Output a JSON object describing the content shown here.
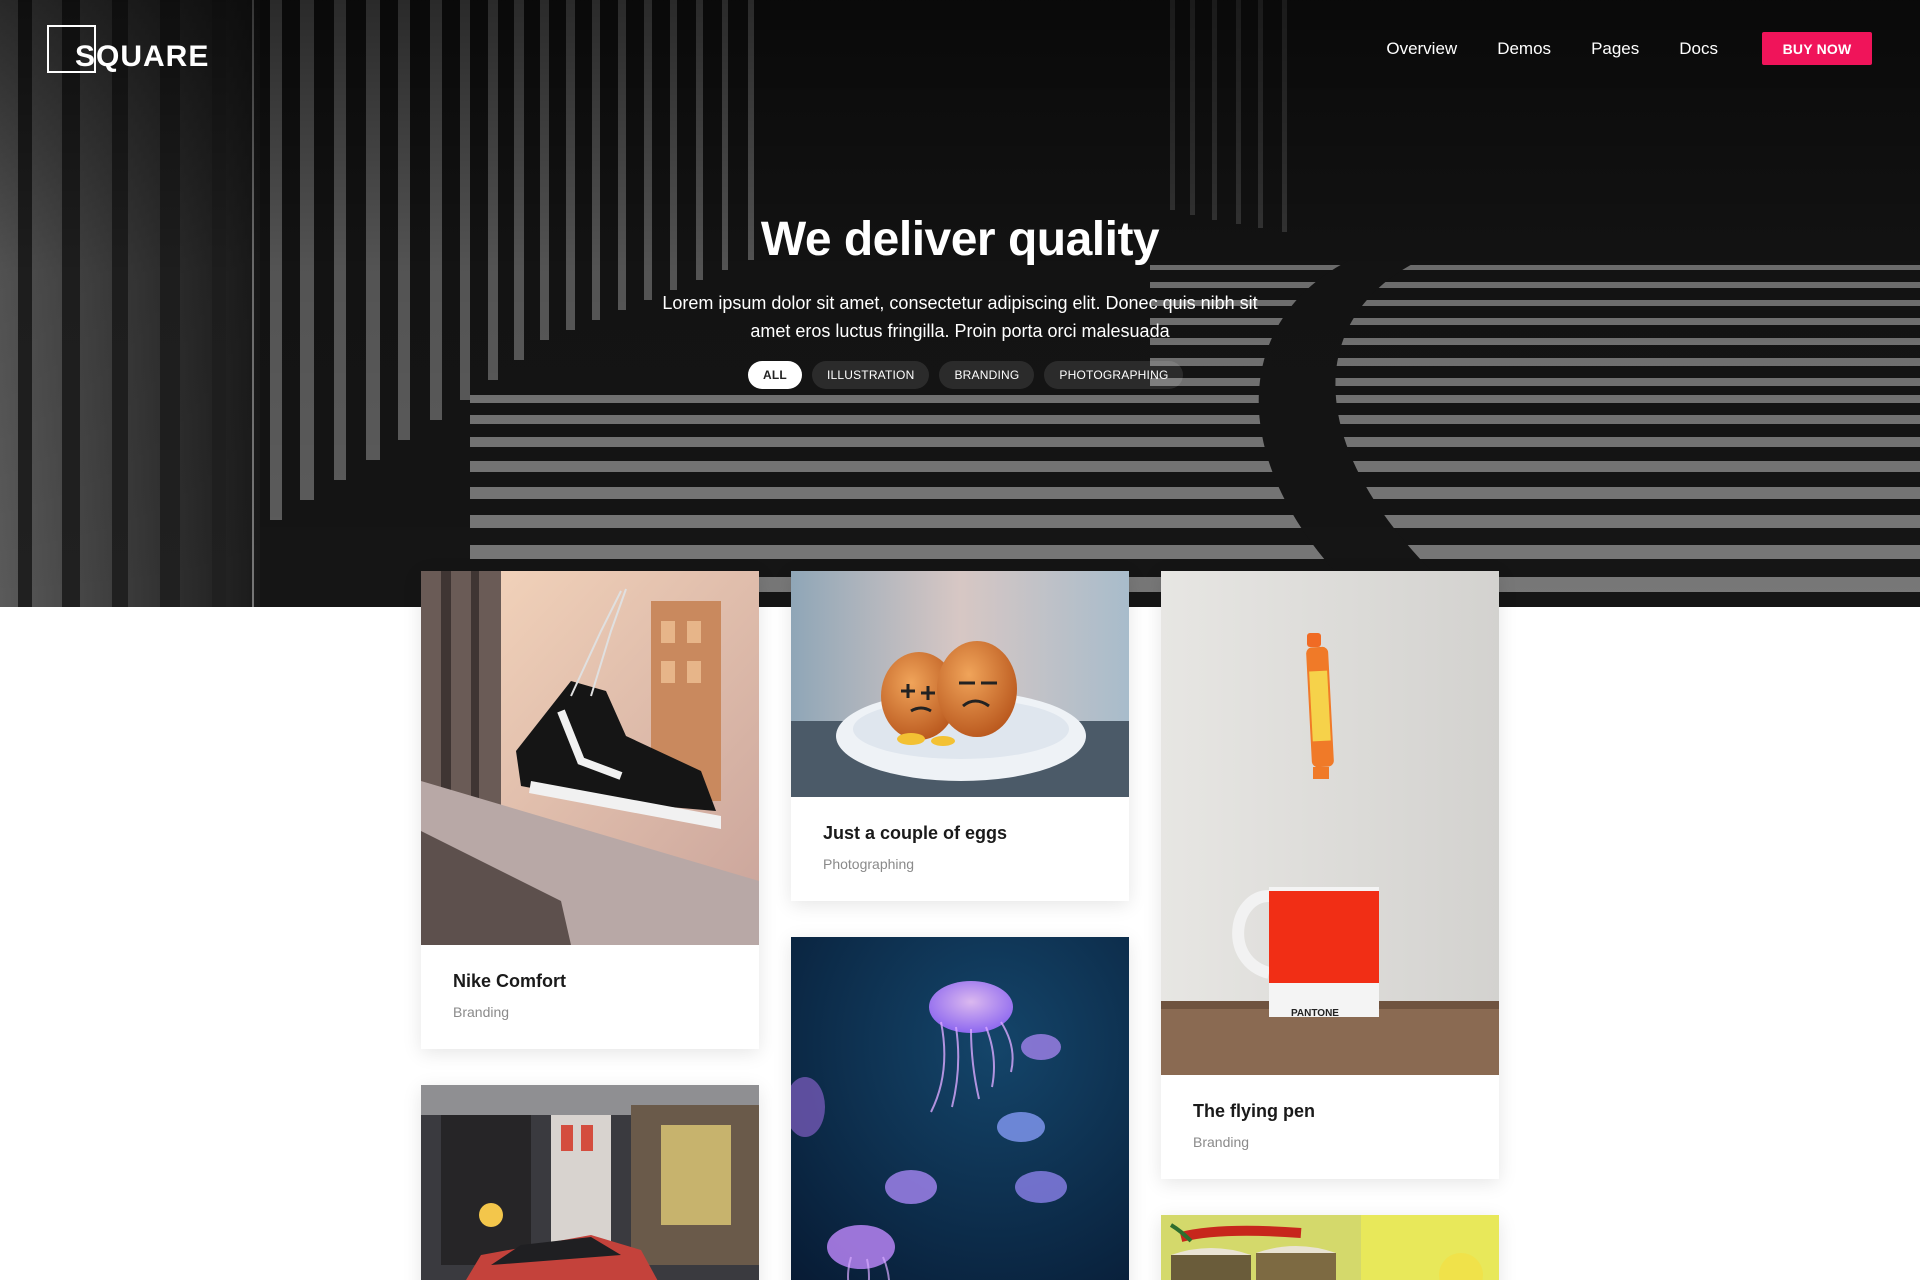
{
  "brand": {
    "logo_text": "SQUARE"
  },
  "nav": {
    "links": [
      "Overview",
      "Demos",
      "Pages",
      "Docs"
    ],
    "cta": "BUY NOW"
  },
  "hero": {
    "title": "We deliver quality",
    "subtitle": "Lorem ipsum dolor sit amet, consectetur adipiscing elit. Donec quis nibh sit amet eros luctus fringilla. Proin porta orci malesuada",
    "filters": [
      {
        "label": "ALL",
        "active": true
      },
      {
        "label": "ILLUSTRATION",
        "active": false
      },
      {
        "label": "BRANDING",
        "active": false
      },
      {
        "label": "PHOTOGRAPHING",
        "active": false
      }
    ]
  },
  "cards": [
    {
      "title": "Nike Comfort",
      "category": "Branding",
      "image": "sneakers-photo"
    },
    {
      "title": "Just a couple of eggs",
      "category": "Photographing",
      "image": "eggs-photo"
    },
    {
      "title": "The flying pen",
      "category": "Branding",
      "image": "pen-mug-photo",
      "mug_text": "PANTONE"
    },
    {
      "image": "street-car-photo"
    },
    {
      "image": "jellyfish-photo"
    },
    {
      "image": "jars-photo"
    }
  ],
  "colors": {
    "accent": "#f0145a",
    "hero_bg": "#141414"
  }
}
